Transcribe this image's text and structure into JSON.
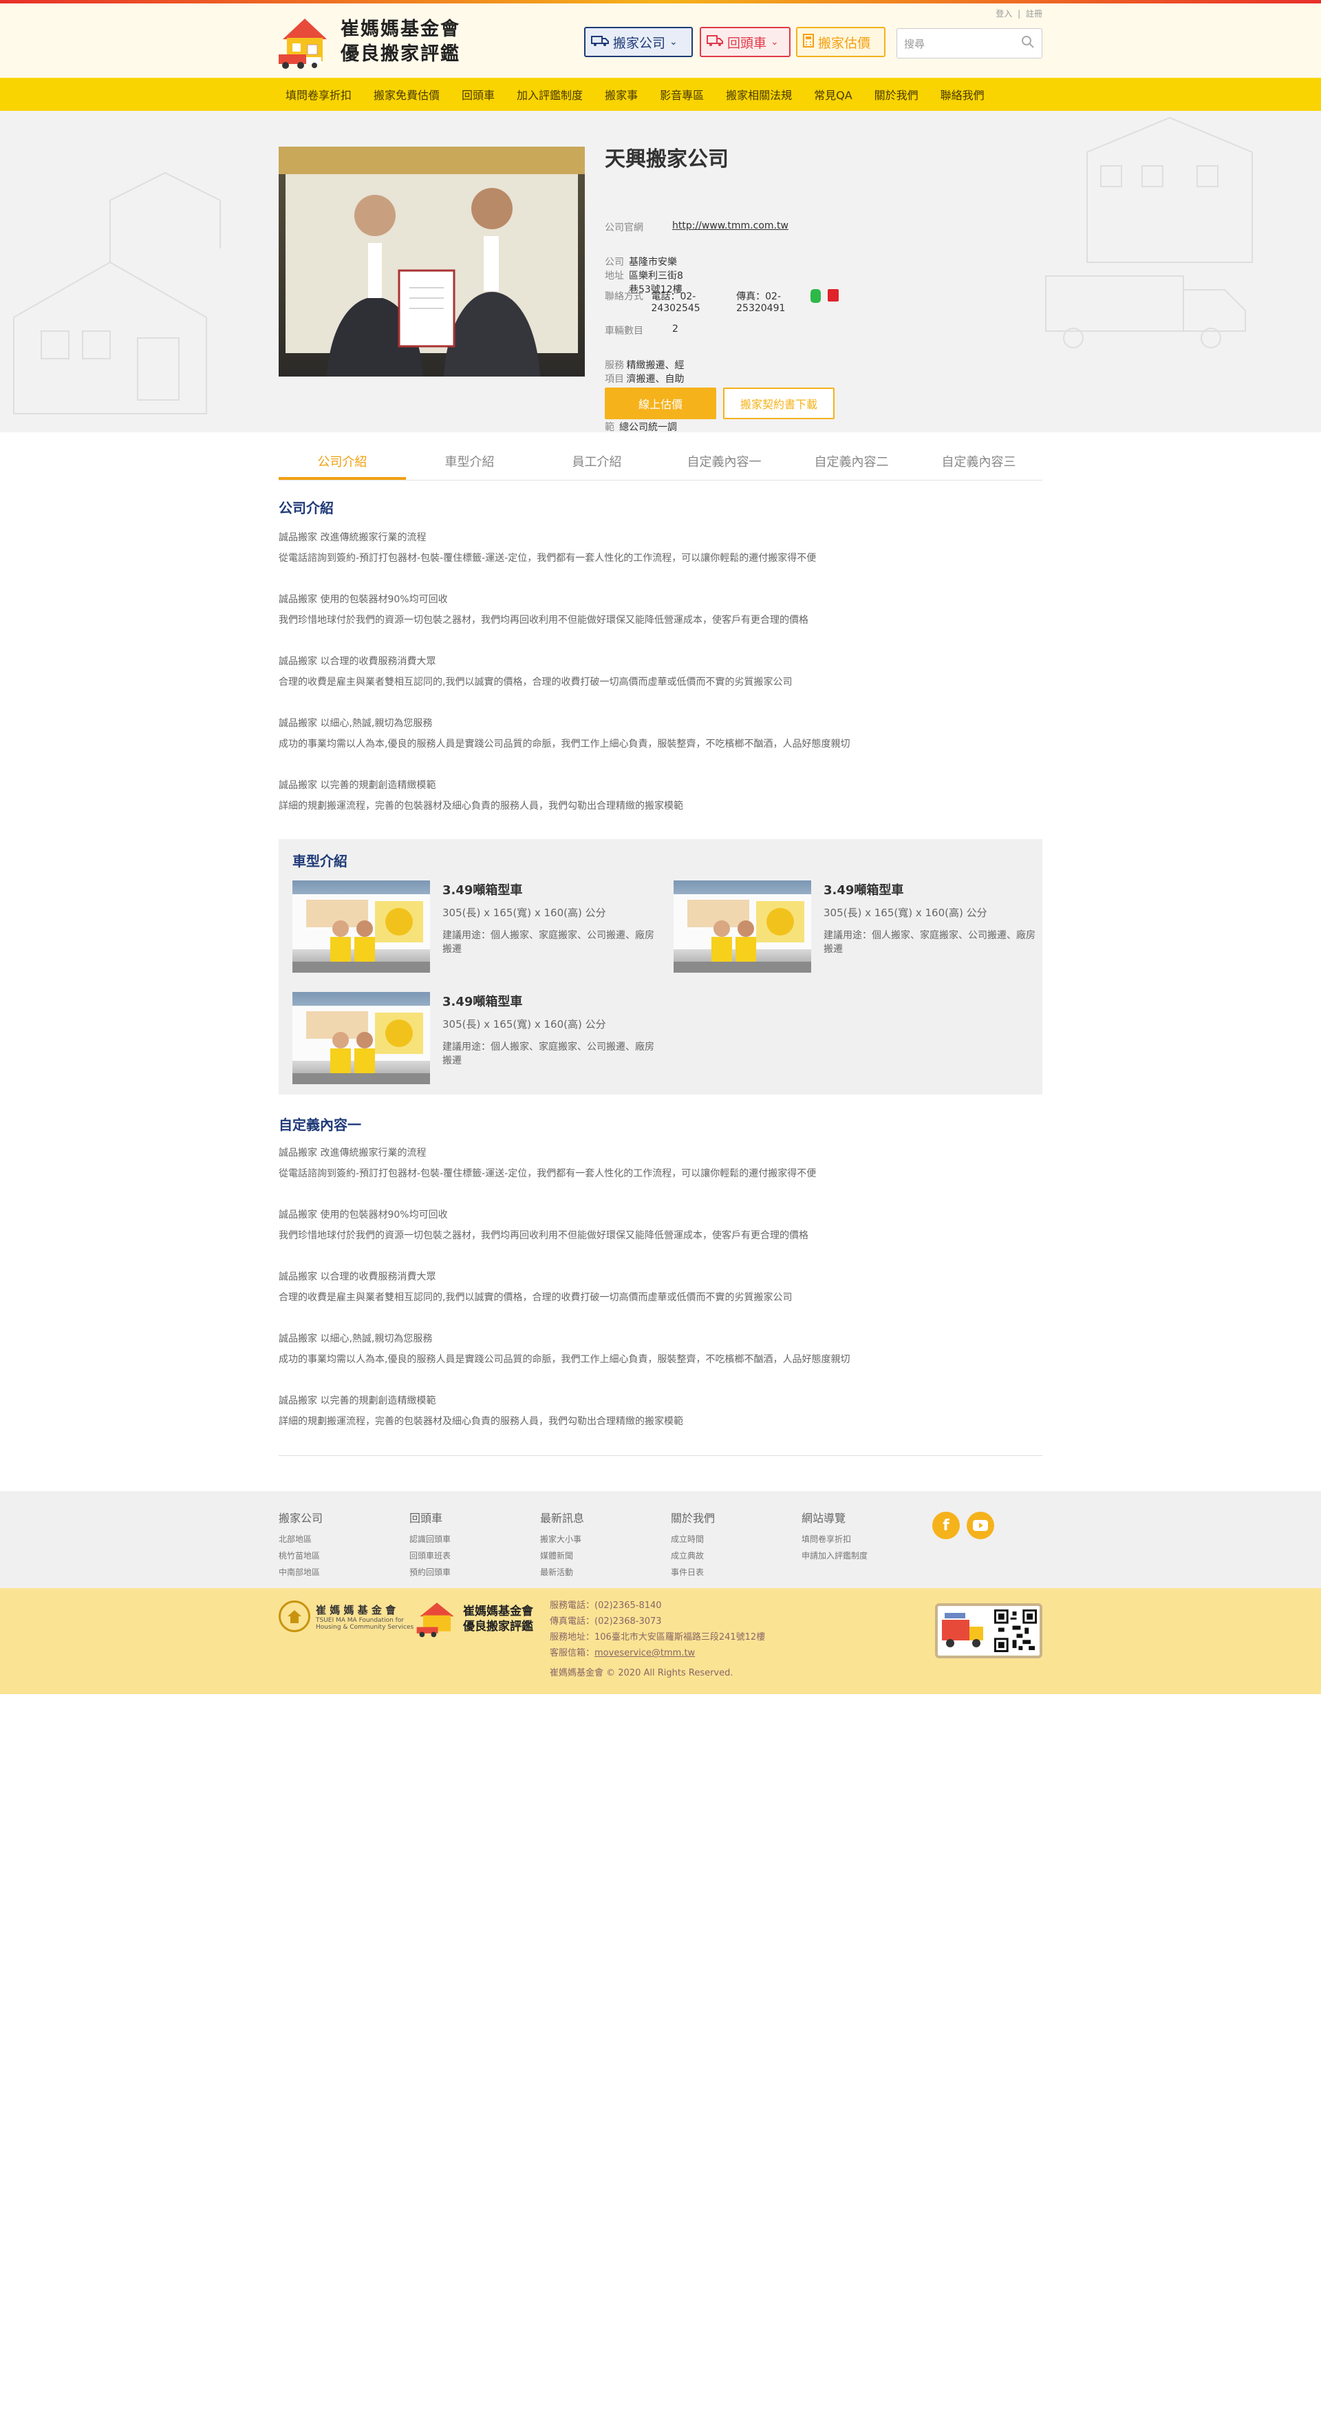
{
  "header": {
    "logo_line1": "崔媽媽基金會",
    "logo_line2": "優良搬家評鑑",
    "login": "登入",
    "sep": "|",
    "register": "註冊",
    "btn_company": "搬家公司",
    "btn_return": "回頭車",
    "btn_estimate": "搬家估價",
    "search_placeholder": "搜尋"
  },
  "nav": [
    "填問卷享折扣",
    "搬家免費估價",
    "回頭車",
    "加入評鑑制度",
    "搬家事",
    "影音專區",
    "搬家相關法規",
    "常見QA",
    "關於我們",
    "聯絡我們"
  ],
  "company": {
    "name": "天興搬家公司",
    "rows": [
      {
        "label": "公司官網",
        "value": "http://www.tmm.com.tw"
      },
      {
        "label": "公司地址",
        "value": "基隆市安樂區樂利三街8巷53號12樓"
      },
      {
        "label": "聯絡方式",
        "value": "電話：02-24302545",
        "value2": "傳真：02-25320491"
      },
      {
        "label": "車輛數目",
        "value": "2"
      },
      {
        "label": "服務項目",
        "value": "精緻搬遷、經濟搬遷、自助搬遷、大型商業搬遷"
      },
      {
        "label": "服務範圍",
        "value": "公司位於台北、基隆、桃園，由總公司統一調度，各區互相支援，可至全省各地"
      }
    ],
    "btn_estimate": "線上估價",
    "btn_contract": "搬家契約書下載"
  },
  "tabs": [
    "公司介紹",
    "車型介紹",
    "員工介紹",
    "自定義內容一",
    "自定義內容二",
    "自定義內容三"
  ],
  "intro": {
    "title": "公司介紹",
    "items": [
      {
        "h": "誠品搬家 改進傳統搬家行業的流程",
        "p": "從電話諮詢到簽約-預訂打包器材-包裝-覆住標籤-運送-定位，我們都有一套人性化的工作流程，可以讓你輕鬆的遷付搬家得不便"
      },
      {
        "h": "誠品搬家 使用的包裝器材90%均可回收",
        "p": "我們珍惜地球付於我們的資源一切包裝之器材，我們均再回收利用不但能做好環保又能降低營運成本，使客戶有更合理的價格"
      },
      {
        "h": "誠品搬家 以合理的收費服務消費大眾",
        "p": "合理的收費是雇主與業者雙相互認同的,我們以誠實的價格，合理的收費打破一切高價而虛華或低價而不實的劣質搬家公司"
      },
      {
        "h": "誠品搬家 以細心,熱誠,親切為您服務",
        "p": "成功的事業均需以人為本,優良的服務人員是實踐公司品質的命脈，我們工作上細心負責，服裝整齊，不吃檳榔不酗酒，人品好態度親切"
      },
      {
        "h": "誠品搬家 以完善的規劃創造精緻模範",
        "p": "詳細的規劃搬運流程，完善的包裝器材及細心負責的服務人員，我們勾勒出合理精緻的搬家模範"
      }
    ]
  },
  "cars": {
    "title": "車型介紹",
    "items": [
      {
        "name": "3.49噸箱型車",
        "size": "305(長) x 165(寬) x 160(高) 公分",
        "use": "建議用途：個人搬家、家庭搬家、公司搬遷、廠房搬遷"
      },
      {
        "name": "3.49噸箱型車",
        "size": "305(長) x 165(寬) x 160(高) 公分",
        "use": "建議用途：個人搬家、家庭搬家、公司搬遷、廠房搬遷"
      },
      {
        "name": "3.49噸箱型車",
        "size": "305(長) x 165(寬) x 160(高) 公分",
        "use": "建議用途：個人搬家、家庭搬家、公司搬遷、廠房搬遷"
      }
    ]
  },
  "custom1": {
    "title": "自定義內容一",
    "items": [
      {
        "h": "誠品搬家 改進傳統搬家行業的流程",
        "p": "從電話諮詢到簽約-預訂打包器材-包裝-覆住標籤-運送-定位，我們都有一套人性化的工作流程，可以讓你輕鬆的遷付搬家得不便"
      },
      {
        "h": "誠品搬家 使用的包裝器材90%均可回收",
        "p": "我們珍惜地球付於我們的資源一切包裝之器材，我們均再回收利用不但能做好環保又能降低營運成本，使客戶有更合理的價格"
      },
      {
        "h": "誠品搬家 以合理的收費服務消費大眾",
        "p": "合理的收費是雇主與業者雙相互認同的,我們以誠實的價格，合理的收費打破一切高價而虛華或低價而不實的劣質搬家公司"
      },
      {
        "h": "誠品搬家 以細心,熱誠,親切為您服務",
        "p": "成功的事業均需以人為本,優良的服務人員是實踐公司品質的命脈，我們工作上細心負責，服裝整齊，不吃檳榔不酗酒，人品好態度親切"
      },
      {
        "h": "誠品搬家 以完善的規劃創造精緻模範",
        "p": "詳細的規劃搬運流程，完善的包裝器材及細心負責的服務人員，我們勾勒出合理精緻的搬家模範"
      }
    ]
  },
  "footer": {
    "cols": [
      {
        "title": "搬家公司",
        "links": [
          "北部地區",
          "桃竹苗地區",
          "中南部地區"
        ]
      },
      {
        "title": "回頭車",
        "links": [
          "認識回頭車",
          "回頭車班表",
          "預約回頭車"
        ]
      },
      {
        "title": "最新訊息",
        "links": [
          "搬家大小事",
          "媒體新聞",
          "最新活動"
        ]
      },
      {
        "title": "關於我們",
        "links": [
          "成立時間",
          "成立典故",
          "事件日表"
        ]
      },
      {
        "title": "網站導覽",
        "links": [
          "填問卷享折扣",
          "申請加入評鑑制度"
        ]
      }
    ],
    "org_name": "崔 媽 媽 基 金 會",
    "org_en1": "TSUEI MA MA Foundation for",
    "org_en2": "Housing & Community Services",
    "logo_line1": "崔媽媽基金會",
    "logo_line2": "優良搬家評鑑",
    "contact": [
      "服務電話：(02)2365-8140",
      "傳真電話：(02)2368-3073",
      "服務地址：106臺北市大安區羅斯福路三段241號12樓"
    ],
    "email_label": "客服信箱：",
    "email": "moveservice@tmm.tw",
    "copyright": "崔媽媽基金會 © 2020 All Rights Reserved."
  },
  "colors": {
    "accent": "#f5b21b",
    "nav": "#f9d400",
    "title_blue": "#1f3a78",
    "return_red": "#e03a4a"
  }
}
